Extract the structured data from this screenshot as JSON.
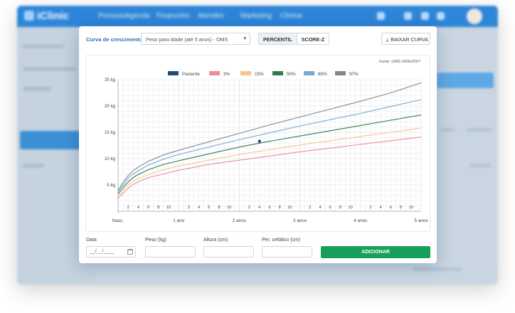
{
  "app": {
    "logo": "iClinic",
    "nav_items": [
      "Pessoas",
      "Agenda",
      "Financeiro",
      "Atendim",
      "Marketing",
      "Clínica"
    ]
  },
  "modal": {
    "curve_label": "Curva de crescimento:",
    "curve_select": {
      "value": "Peso para idade (até 5 anos) - OMS",
      "arrow_icon": "caret-down-icon"
    },
    "tabs": [
      {
        "label": "PERCENTIL",
        "active": true
      },
      {
        "label": "SCORE-Z",
        "active": false
      }
    ],
    "download_label": "BAIXAR CURVA",
    "download_icon": "download-icon",
    "source_note": "Fonte: OMS 2006/2007",
    "form": {
      "date_label": "Data",
      "date_placeholder": "__/__/____",
      "weight_label": "Peso (kg)",
      "height_label": "Altura (cm)",
      "head_label": "Per. cefálico (cm)",
      "add_label": "ADICIONAR",
      "add_color": "#16a05a"
    }
  },
  "chart_data": {
    "type": "line",
    "legend_position": "top",
    "grid": true,
    "ylim": [
      0,
      25
    ],
    "xlim": [
      0,
      60
    ],
    "y_ticks": [
      {
        "value": 25,
        "label": "25 kg"
      },
      {
        "value": 20,
        "label": "20 kg"
      },
      {
        "value": 15,
        "label": "15 kg"
      },
      {
        "value": 10,
        "label": "10 kg"
      },
      {
        "value": 5,
        "label": "5 kg"
      }
    ],
    "x_major_ticks": [
      {
        "value": 0,
        "label": "Nasc."
      },
      {
        "value": 12,
        "label": "1 ano"
      },
      {
        "value": 24,
        "label": "2 anos"
      },
      {
        "value": 36,
        "label": "3 anos"
      },
      {
        "value": 48,
        "label": "4 anos"
      },
      {
        "value": 60,
        "label": "5 anos"
      }
    ],
    "x_minor_ticks": [
      {
        "value": 2,
        "label": "2"
      },
      {
        "value": 4,
        "label": "4"
      },
      {
        "value": 6,
        "label": "6"
      },
      {
        "value": 8,
        "label": "8"
      },
      {
        "value": 10,
        "label": "10"
      },
      {
        "value": 14,
        "label": "2"
      },
      {
        "value": 16,
        "label": "4"
      },
      {
        "value": 18,
        "label": "6"
      },
      {
        "value": 20,
        "label": "8"
      },
      {
        "value": 22,
        "label": "10"
      },
      {
        "value": 26,
        "label": "2"
      },
      {
        "value": 28,
        "label": "4"
      },
      {
        "value": 30,
        "label": "6"
      },
      {
        "value": 32,
        "label": "8"
      },
      {
        "value": 34,
        "label": "10"
      },
      {
        "value": 38,
        "label": "2"
      },
      {
        "value": 40,
        "label": "4"
      },
      {
        "value": 42,
        "label": "6"
      },
      {
        "value": 44,
        "label": "8"
      },
      {
        "value": 46,
        "label": "10"
      },
      {
        "value": 50,
        "label": "2"
      },
      {
        "value": 52,
        "label": "4"
      },
      {
        "value": 54,
        "label": "6"
      },
      {
        "value": 56,
        "label": "8"
      },
      {
        "value": 58,
        "label": "10"
      }
    ],
    "x": [
      0,
      1,
      2,
      3,
      4,
      6,
      9,
      12,
      18,
      24,
      30,
      36,
      42,
      48,
      54,
      60
    ],
    "series": [
      {
        "name": "3%",
        "color": "#ee8d95",
        "values": [
          2.5,
          3.4,
          4.4,
          5.1,
          5.6,
          6.4,
          7.1,
          7.8,
          8.9,
          9.7,
          10.5,
          11.3,
          12.0,
          12.7,
          13.4,
          14.1
        ]
      },
      {
        "name": "15%",
        "color": "#f3c889",
        "values": [
          2.9,
          3.9,
          5.0,
          5.7,
          6.2,
          7.0,
          7.9,
          8.6,
          9.7,
          10.8,
          11.7,
          12.6,
          13.4,
          14.2,
          15.0,
          15.8
        ]
      },
      {
        "name": "50%",
        "color": "#2f7d4f",
        "values": [
          3.3,
          4.5,
          5.6,
          6.4,
          7.0,
          7.9,
          8.9,
          9.6,
          10.9,
          12.2,
          13.3,
          14.3,
          15.3,
          16.3,
          17.3,
          18.3
        ]
      },
      {
        "name": "85%",
        "color": "#7aa8cf",
        "values": [
          3.7,
          5.0,
          6.3,
          7.1,
          7.7,
          8.8,
          9.9,
          10.8,
          12.2,
          13.6,
          14.9,
          16.2,
          17.4,
          18.6,
          19.9,
          21.2
        ]
      },
      {
        "name": "97%",
        "color": "#7e8891",
        "values": [
          4.0,
          5.5,
          6.8,
          7.7,
          8.4,
          9.5,
          10.7,
          11.6,
          13.2,
          14.8,
          16.4,
          17.9,
          19.4,
          20.9,
          22.5,
          24.4
        ]
      }
    ],
    "patient": {
      "name": "Paciente",
      "color": "#1f4e79",
      "points": [
        {
          "x": 28,
          "y": 13.3
        }
      ]
    }
  }
}
